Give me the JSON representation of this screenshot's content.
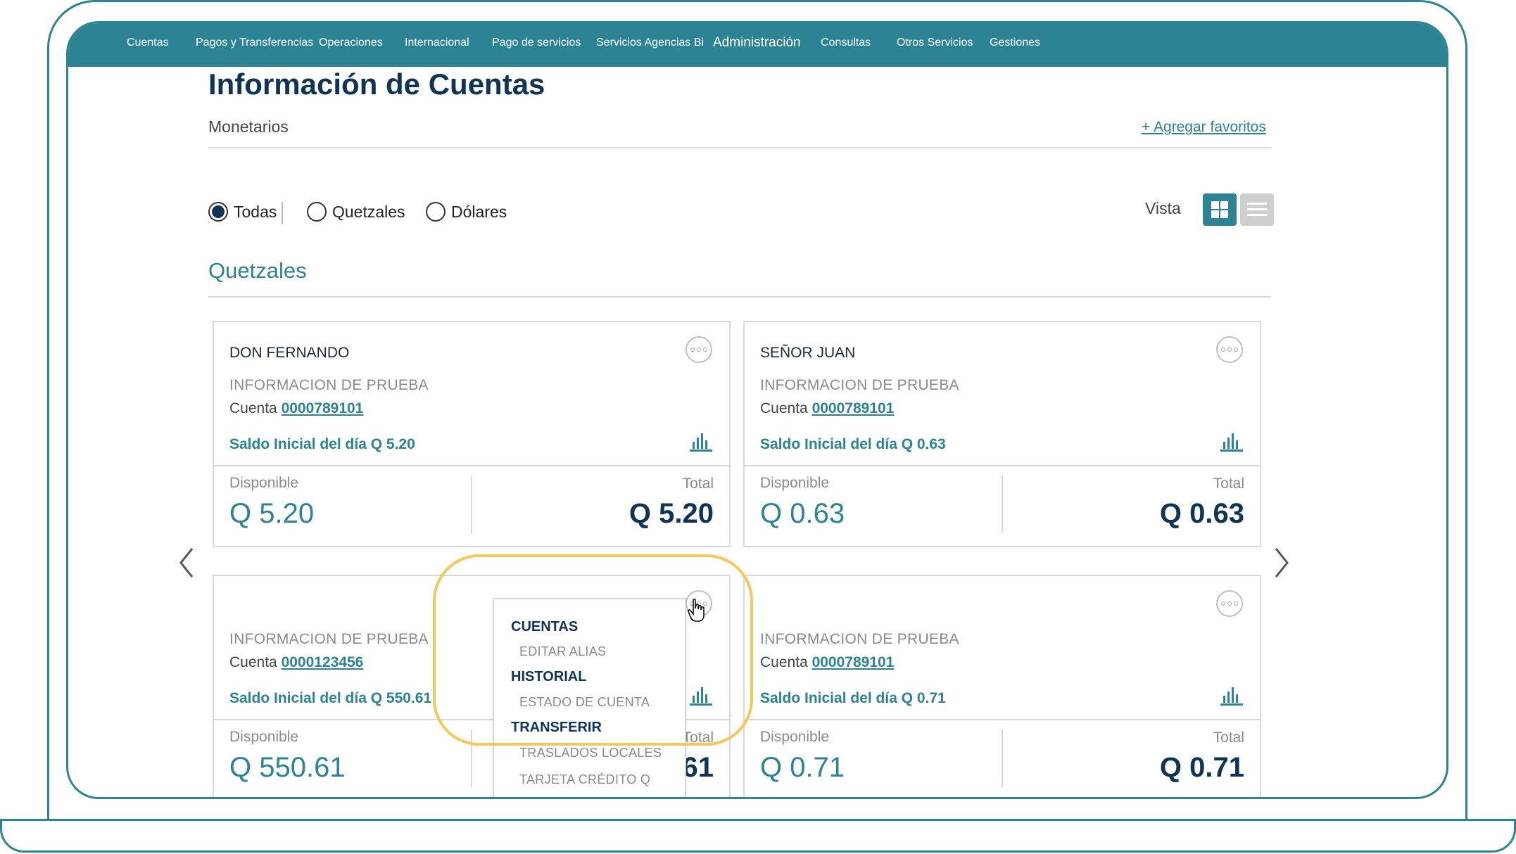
{
  "nav": {
    "items": [
      "Cuentas",
      "Pagos y Transferencias",
      "Operaciones",
      "Internacional",
      "Pago de servicios",
      "Servicios Agencias Bi",
      "Administración",
      "Consultas",
      "Otros Servicios",
      "Gestiones"
    ]
  },
  "header": {
    "title": "Información de Cuentas",
    "subtitle": "Monetarios",
    "favorites_link": "+ Agregar favoritos"
  },
  "filters": {
    "options": [
      "Todas",
      "Quetzales",
      "Dólares"
    ],
    "selected": "Todas"
  },
  "view": {
    "label": "Vista",
    "active": "grid"
  },
  "section": {
    "title": "Quetzales"
  },
  "cards": [
    {
      "name": "DON FERNANDO",
      "info": "INFORMACION DE PRUEBA",
      "account_label": "Cuenta",
      "account_number": "0000789101",
      "saldo": "Saldo Inicial del día Q 5.20",
      "disponible_label": "Disponible",
      "disponible": "Q 5.20",
      "total_label": "Total",
      "total": "Q 5.20"
    },
    {
      "name": "SEÑOR JUAN",
      "info": "INFORMACION DE PRUEBA",
      "account_label": "Cuenta",
      "account_number": "0000789101",
      "saldo": "Saldo Inicial del día Q 0.63",
      "disponible_label": "Disponible",
      "disponible": "Q 0.63",
      "total_label": "Total",
      "total": "Q 0.63"
    },
    {
      "name": "",
      "info": "INFORMACION DE PRUEBA",
      "account_label": "Cuenta",
      "account_number": "0000123456",
      "saldo": "Saldo Inicial del día Q 550.61",
      "disponible_label": "Disponible",
      "disponible": "Q 550.61",
      "total_label": "Total",
      "total": "61"
    },
    {
      "name": "",
      "info": "INFORMACION DE PRUEBA",
      "account_label": "Cuenta",
      "account_number": "0000789101",
      "saldo": "Saldo Inicial del día Q 0.71",
      "disponible_label": "Disponible",
      "disponible": "Q 0.71",
      "total_label": "Total",
      "total": "Q 0.71"
    }
  ],
  "dropdown": {
    "sections": [
      {
        "title": "CUENTAS",
        "items": [
          "EDITAR ALIAS"
        ]
      },
      {
        "title": "HISTORIAL",
        "items": [
          "ESTADO DE CUENTA"
        ]
      },
      {
        "title": "TRANSFERIR",
        "items": [
          "TRASLADOS LOCALES",
          "TARJETA CRÉDITO Q"
        ]
      }
    ]
  },
  "colors": {
    "brand": "#2b8393",
    "navy": "#0f3455",
    "highlight": "#f6c85a"
  }
}
